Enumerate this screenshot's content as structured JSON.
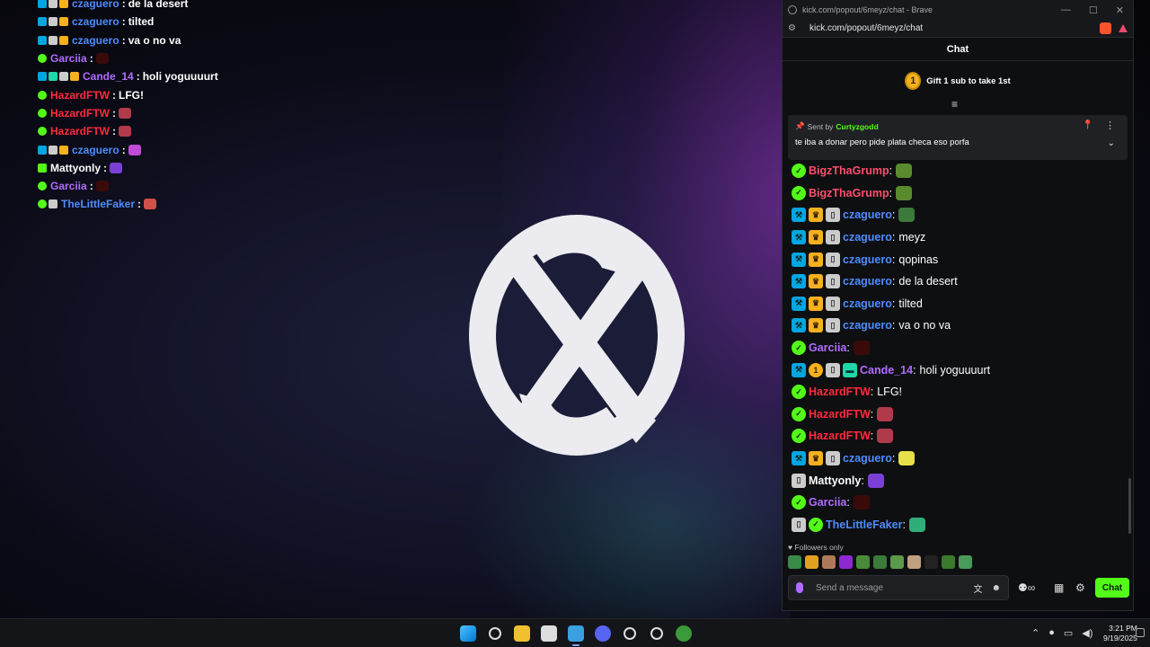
{
  "browser": {
    "window_title": "kick.com/popout/6meyz/chat - Brave",
    "window_controls": [
      "—",
      "☐",
      "✕"
    ],
    "url": "kick.com/popout/6meyz/chat"
  },
  "chat": {
    "header": "Chat",
    "gift_text": "Gift 1 sub to take 1st",
    "gift_badge": "1",
    "pinned": {
      "sent_by_label": "Sent by",
      "sender": "Curtyzgodd",
      "text": "te iba a donar pero pide plata checa eso porfa"
    },
    "messages": [
      {
        "user": "BigzThaGrump",
        "color": "#ff4d6d",
        "text": "",
        "badges": [
          "verified"
        ],
        "emote": "#5a8a2e"
      },
      {
        "user": "BigzThaGrump",
        "color": "#ff4d6d",
        "text": "",
        "badges": [
          "verified"
        ],
        "emote": "#5a8a2e"
      },
      {
        "user": "czaguero",
        "color": "#4f8cff",
        "text": "",
        "badges": [
          "mod",
          "vip",
          "og"
        ],
        "emote": "#3b7a3b"
      },
      {
        "user": "czaguero",
        "color": "#4f8cff",
        "text": "meyz",
        "badges": [
          "mod",
          "vip",
          "og"
        ],
        "emote": ""
      },
      {
        "user": "czaguero",
        "color": "#4f8cff",
        "text": "qopinas",
        "badges": [
          "mod",
          "vip",
          "og"
        ],
        "emote": ""
      },
      {
        "user": "czaguero",
        "color": "#4f8cff",
        "text": "de la desert",
        "badges": [
          "mod",
          "vip",
          "og"
        ],
        "emote": ""
      },
      {
        "user": "czaguero",
        "color": "#4f8cff",
        "text": "tilted",
        "badges": [
          "mod",
          "vip",
          "og"
        ],
        "emote": ""
      },
      {
        "user": "czaguero",
        "color": "#4f8cff",
        "text": "va o no va",
        "badges": [
          "mod",
          "vip",
          "og"
        ],
        "emote": ""
      },
      {
        "user": "Garciia",
        "color": "#b06cff",
        "text": "",
        "badges": [
          "verified"
        ],
        "emote": "#3a0a0a"
      },
      {
        "user": "Cande_14",
        "color": "#b06cff",
        "text": "holi yoguuuurt",
        "badges": [
          "mod",
          "sub1",
          "og",
          "gift"
        ],
        "emote": ""
      },
      {
        "user": "HazardFTW",
        "color": "#ff2a3c",
        "text": "LFG!",
        "badges": [
          "verified"
        ],
        "emote": ""
      },
      {
        "user": "HazardFTW",
        "color": "#ff2a3c",
        "text": "",
        "badges": [
          "verified"
        ],
        "emote": "#b03a4a"
      },
      {
        "user": "HazardFTW",
        "color": "#ff2a3c",
        "text": "",
        "badges": [
          "verified"
        ],
        "emote": "#b03a4a"
      },
      {
        "user": "czaguero",
        "color": "#4f8cff",
        "text": "",
        "badges": [
          "mod",
          "vip",
          "og"
        ],
        "emote": "#e6e04a"
      },
      {
        "user": "Mattyonly",
        "color": "#ffffff",
        "text": "",
        "badges": [
          "og"
        ],
        "emote": "#7b3fd6"
      },
      {
        "user": "Garciia",
        "color": "#b06cff",
        "text": "",
        "badges": [
          "verified"
        ],
        "emote": "#3a0a0a"
      },
      {
        "user": "TheLittleFaker",
        "color": "#4f8cff",
        "text": "",
        "badges": [
          "og",
          "verified"
        ],
        "emote": "#2fae7a"
      }
    ],
    "followers_only": "Followers only",
    "input_placeholder": "Send a message",
    "send_label": "Chat"
  },
  "overlay": {
    "lines": [
      {
        "user": "czaguero",
        "color": "#4f8cff",
        "text": "de la desert",
        "badges": [
          "mod",
          "og",
          "vip"
        ],
        "emote": ""
      },
      {
        "user": "czaguero",
        "color": "#4f8cff",
        "text": "tilted",
        "badges": [
          "mod",
          "og",
          "vip"
        ],
        "emote": ""
      },
      {
        "user": "czaguero",
        "color": "#4f8cff",
        "text": "va o no va",
        "badges": [
          "mod",
          "og",
          "vip"
        ],
        "emote": ""
      },
      {
        "user": "Garciia",
        "color": "#b06cff",
        "text": "",
        "badges": [
          "verified"
        ],
        "emote": "#3a0a0a"
      },
      {
        "user": "Cande_14",
        "color": "#b06cff",
        "text": "holi yoguuuurt",
        "badges": [
          "mod",
          "gift",
          "og",
          "sub1"
        ],
        "emote": ""
      },
      {
        "user": "HazardFTW",
        "color": "#ff2a3c",
        "text": "LFG!",
        "badges": [
          "verified"
        ],
        "emote": ""
      },
      {
        "user": "HazardFTW",
        "color": "#ff2a3c",
        "text": "",
        "badges": [
          "verified"
        ],
        "emote": "#b03a4a"
      },
      {
        "user": "HazardFTW",
        "color": "#ff2a3c",
        "text": "",
        "badges": [
          "verified"
        ],
        "emote": "#b03a4a"
      },
      {
        "user": "czaguero",
        "color": "#4f8cff",
        "text": "",
        "badges": [
          "mod",
          "og",
          "vip"
        ],
        "emote": "#c04bd6"
      },
      {
        "user": "Mattyonly",
        "color": "#ffffff",
        "text": "",
        "badges": [
          "plus"
        ],
        "emote": "#7b3fd6"
      },
      {
        "user": "Garciia",
        "color": "#b06cff",
        "text": "",
        "badges": [
          "verified"
        ],
        "emote": "#3a0a0a"
      },
      {
        "user": "TheLittleFaker",
        "color": "#4f8cff",
        "text": "",
        "badges": [
          "verified",
          "og"
        ],
        "emote": "#d0504a"
      }
    ]
  },
  "taskbar": {
    "time": "3:21 PM",
    "date": "9/19/2025"
  }
}
